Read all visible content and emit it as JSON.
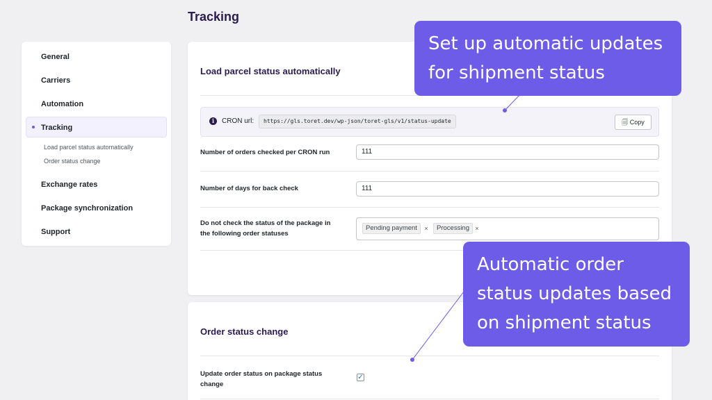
{
  "page": {
    "title": "Tracking"
  },
  "sidebar": {
    "items": [
      {
        "label": "General"
      },
      {
        "label": "Carriers"
      },
      {
        "label": "Automation"
      },
      {
        "label": "Tracking"
      },
      {
        "label": "Exchange rates"
      },
      {
        "label": "Package synchronization"
      },
      {
        "label": "Support"
      }
    ],
    "subitems": [
      {
        "label": "Load parcel status automatically"
      },
      {
        "label": "Order status change"
      }
    ]
  },
  "load_section": {
    "title": "Load parcel status automatically",
    "cron_label": "CRON url:",
    "cron_url": "https://gls.toret.dev/wp-json/toret-gls/v1/status-update",
    "copy_label": "Copy",
    "orders_per_run": {
      "label": "Number of orders checked per CRON run",
      "value": "111"
    },
    "days_back": {
      "label": "Number of days for back check",
      "value": "111"
    },
    "skip_statuses": {
      "label_line1": "Do not check the status of the package in",
      "label_line2": "the following order statuses",
      "tags": [
        "Pending payment",
        "Processing"
      ],
      "remove_symbol": "×"
    }
  },
  "order_section": {
    "title": "Order status change",
    "update_label_line1": "Update order status on package status",
    "update_label_line2": "change",
    "checked": true,
    "check_symbol": "✓"
  },
  "callouts": {
    "top": {
      "line1": "Set up automatic updates",
      "line2": "for shipment status"
    },
    "bottom": {
      "line1": "Automatic order",
      "line2": "status updates based",
      "line3": "on shipment status"
    }
  },
  "colors": {
    "accent": "#6c5ce7",
    "title": "#2b1b4e"
  }
}
